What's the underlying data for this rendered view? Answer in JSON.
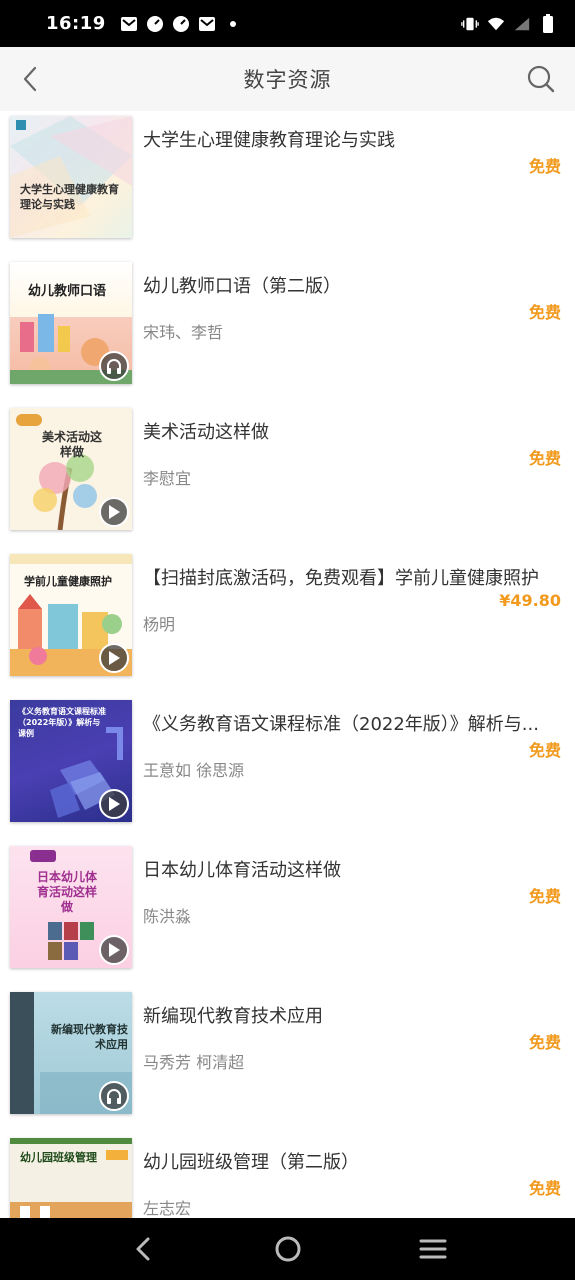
{
  "status_bar": {
    "time": "16:19",
    "left_icons": [
      "mail-icon",
      "speedometer-icon",
      "speedometer-icon",
      "mail-icon",
      "dot-icon"
    ],
    "right_icons": [
      "vibrate-icon",
      "wifi-icon",
      "signal-icon",
      "battery-icon"
    ]
  },
  "header": {
    "title": "数字资源",
    "back_icon": "chevron-left-icon",
    "search_icon": "search-icon"
  },
  "colors": {
    "price": "#f29a1e",
    "header_bg": "#f6f6f6",
    "title_text": "#333333",
    "author_text": "#888888"
  },
  "books": [
    {
      "title": "大学生心理健康教育理论与实践",
      "author": "",
      "price": "免费",
      "cover": {
        "title": "大学生心理健康教育理论与实践",
        "badge": ""
      }
    },
    {
      "title": "幼儿教师口语（第二版）",
      "author": "宋玮、李哲",
      "price": "免费",
      "cover": {
        "title": "幼儿教师口语",
        "badge": "headphones-icon"
      }
    },
    {
      "title": "美术活动这样做",
      "author": "李慰宜",
      "price": "免费",
      "cover": {
        "title": "美术活动这样做",
        "badge": "play-icon"
      }
    },
    {
      "title": "【扫描封底激活码，免费观看】学前儿童健康照护",
      "author": "杨明",
      "price": "¥49.80",
      "cover": {
        "title": "学前儿童健康照护",
        "badge": "play-icon"
      }
    },
    {
      "title": "《义务教育语文课程标准（2022年版）》解析与...",
      "author": "王意如  徐思源",
      "price": "免费",
      "cover": {
        "title": "《义务教育语文课程标准（2022年版）》解析与课例",
        "badge": "play-icon"
      }
    },
    {
      "title": "日本幼儿体育活动这样做",
      "author": "陈洪淼",
      "price": "免费",
      "cover": {
        "title": "日本幼儿体育活动这样做",
        "badge": "play-icon"
      }
    },
    {
      "title": "新编现代教育技术应用",
      "author": "马秀芳 柯清超",
      "price": "免费",
      "cover": {
        "title": "新编现代教育技术应用",
        "badge": "headphones-icon"
      }
    },
    {
      "title": "幼儿园班级管理（第二版）",
      "author": "左志宏",
      "price": "免费",
      "cover": {
        "title": "幼儿园班级管理",
        "badge": ""
      }
    }
  ],
  "nav_bar": {
    "icons": [
      "back-triangle-icon",
      "home-circle-icon",
      "menu-lines-icon"
    ]
  }
}
